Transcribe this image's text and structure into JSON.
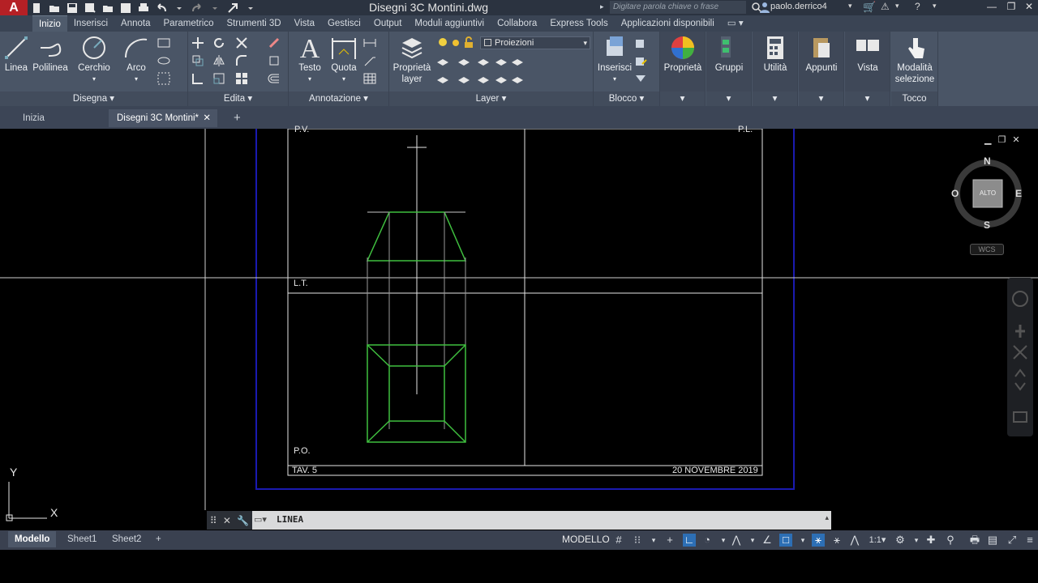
{
  "title_bar": {
    "logo": "A",
    "document_title": "Disegni 3C Montini.dwg",
    "search_placeholder": "Digitare parola chiave o frase",
    "user": "paolo.derrico4",
    "icons": [
      "new-icon",
      "open-icon",
      "save-icon",
      "save-as-icon",
      "web-open-icon",
      "web-save-icon",
      "print-icon",
      "undo-icon",
      "redo-icon",
      "share-icon"
    ]
  },
  "menu": {
    "tabs": [
      "Inizio",
      "Inserisci",
      "Annota",
      "Parametrico",
      "Strumenti 3D",
      "Vista",
      "Gestisci",
      "Output",
      "Moduli aggiuntivi",
      "Collabora",
      "Express Tools",
      "Applicazioni disponibili"
    ],
    "active": "Inizio"
  },
  "ribbon": {
    "draw": {
      "title": "Disegna",
      "buttons": [
        "Linea",
        "Polilinea",
        "Cerchio",
        "Arco"
      ]
    },
    "edit": {
      "title": "Edita"
    },
    "annotation": {
      "title": "Annotazione",
      "buttons": [
        "Testo",
        "Quota"
      ]
    },
    "layer": {
      "title": "Layer",
      "properties_line1": "Proprietà",
      "properties_line2": "layer",
      "current_layer": "Proiezioni"
    },
    "block": {
      "title": "Blocco",
      "insert": "Inserisci"
    },
    "properties": {
      "label": "Proprietà"
    },
    "groups": {
      "label": "Gruppi"
    },
    "utility": {
      "label": "Utilità"
    },
    "clipboard": {
      "label": "Appunti"
    },
    "view": {
      "label": "Vista"
    },
    "touch": {
      "title": "Tocco",
      "line1": "Modalità",
      "line2": "selezione"
    }
  },
  "doc_tabs": {
    "start": "Inizia",
    "active": "Disegni 3C Montini*"
  },
  "drawing": {
    "label_pv": "P.V.",
    "label_pl": "P.L.",
    "label_lt": "L.T.",
    "label_po": "P.O.",
    "sheet": "TAV. 5",
    "date": "20 NOVEMBRE 2019"
  },
  "ucs": {
    "y": "Y",
    "x": "X"
  },
  "viewcube": {
    "n": "N",
    "s": "S",
    "e": "E",
    "w": "O",
    "face": "ALTO",
    "wcs": "WCS"
  },
  "command_line": {
    "text": "LINEA"
  },
  "status_bar": {
    "layouts": [
      "Modello",
      "Sheet1",
      "Sheet2"
    ],
    "active_layout": "Modello",
    "space": "MODELLO",
    "scale": "1:1"
  },
  "colors": {
    "green_lines": "#3fbf3f",
    "white_lines": "#e6e6e6",
    "blue_border": "#1a1ab0",
    "ribbon_bg": "#4a5566"
  }
}
